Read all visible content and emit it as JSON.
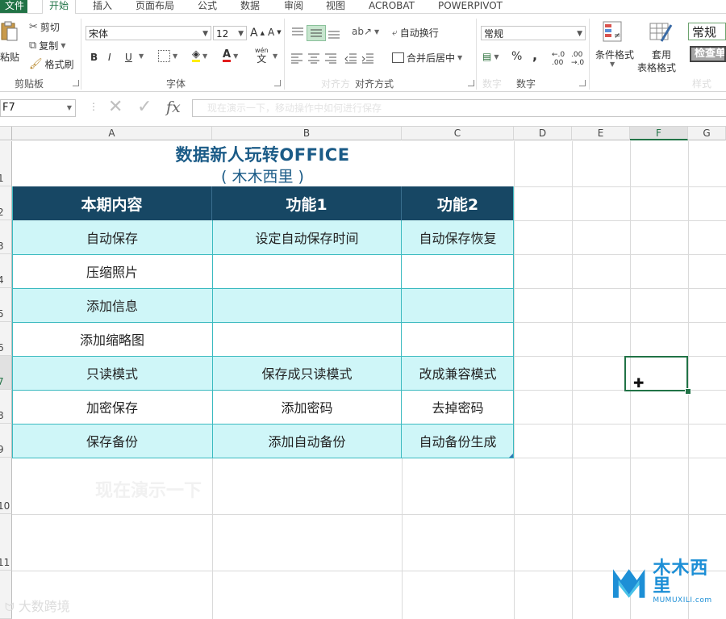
{
  "ribbon_tabs": [
    {
      "label": "文件",
      "active": false
    },
    {
      "label": "开始",
      "active": true
    },
    {
      "label": "插入",
      "active": false
    },
    {
      "label": "页面布局",
      "active": false
    },
    {
      "label": "公式",
      "active": false
    },
    {
      "label": "数据",
      "active": false
    },
    {
      "label": "审阅",
      "active": false
    },
    {
      "label": "视图",
      "active": false
    },
    {
      "label": "ACROBAT",
      "active": false
    },
    {
      "label": "POWERPIVOT",
      "active": false
    }
  ],
  "clipboard": {
    "paste": "粘贴",
    "cut": "剪切",
    "copy": "复制",
    "format_painter": "格式刷",
    "group_label": "剪贴板"
  },
  "font": {
    "font_name": "宋体",
    "font_size": "12",
    "group_label": "字体",
    "bold": "B",
    "italic": "I",
    "underline": "U",
    "grow": "A",
    "shrink": "A",
    "phonetic": "wén"
  },
  "alignment": {
    "wrap_text": "自动换行",
    "merge_center": "合并后居中",
    "group_label": "对齐方式",
    "ghost_label": "对齐方"
  },
  "number": {
    "format": "常规",
    "percent": "%",
    "comma": ",",
    "group_label": "数字",
    "ghost_label": "数字"
  },
  "styles": {
    "conditional_format": "条件格式",
    "format_as_table_1": "套用",
    "format_as_table_2": "表格格式",
    "style_normal": "常规",
    "style_check": "检查单",
    "ghost_label": "样式"
  },
  "formula_bar": {
    "name_box": "F7",
    "formula_ghost": "现在演示一下，移动操作中如何进行保存"
  },
  "columns": [
    "A",
    "B",
    "C",
    "D",
    "E",
    "F",
    "G"
  ],
  "selected_column": "F",
  "rows": [
    "1",
    "2",
    "3",
    "4",
    "5",
    "6",
    "7",
    "8",
    "9",
    "10",
    "11"
  ],
  "selected_row": "7",
  "sheet": {
    "title": "数据新人玩转OFFICE",
    "subtitle": "( 木木西里 )",
    "headers": [
      "本期内容",
      "功能1",
      "功能2"
    ],
    "rows": [
      [
        "自动保存",
        "设定自动保存时间",
        "自动保存恢复"
      ],
      [
        "压缩照片",
        "",
        ""
      ],
      [
        "添加信息",
        "",
        ""
      ],
      [
        "添加缩略图",
        "",
        ""
      ],
      [
        "只读模式",
        "保存成只读模式",
        "改成兼容模式"
      ],
      [
        "加密保存",
        "添加密码",
        "去掉密码"
      ],
      [
        "保存备份",
        "添加自动备份",
        "自动备份生成"
      ]
    ]
  },
  "overlay": {
    "ghost_caption": "现在演示一下",
    "logo_cn": "木木西里",
    "logo_en": "MUMUXILI.com",
    "watermark": "大数跨境"
  },
  "colors": {
    "header_bg": "#174764",
    "band_bg": "#cff6f8",
    "border": "#3bbac0",
    "title": "#1b5b87",
    "excel_green": "#217346"
  }
}
